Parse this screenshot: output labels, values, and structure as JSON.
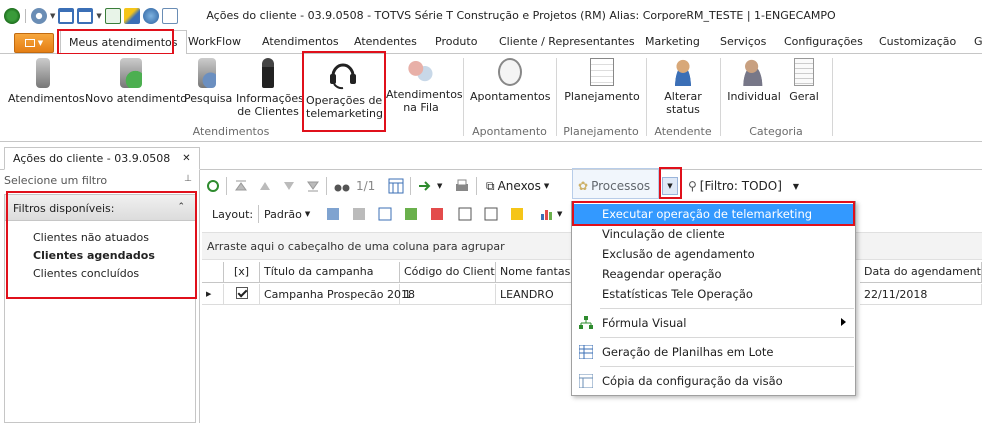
{
  "window": {
    "title": "Ações do cliente - 03.9.0508 - TOTVS Série T Construção e Projetos (RM) Alias: CorporeRM_TESTE | 1-ENGECAMPO"
  },
  "ribbon_tabs": [
    {
      "label": "Meus atendimentos"
    },
    {
      "label": "WorkFlow"
    },
    {
      "label": "Atendimentos"
    },
    {
      "label": "Atendentes"
    },
    {
      "label": "Produto"
    },
    {
      "label": "Cliente / Representantes"
    },
    {
      "label": "Marketing"
    },
    {
      "label": "Serviços"
    },
    {
      "label": "Configurações"
    },
    {
      "label": "Customização"
    },
    {
      "label": "G"
    }
  ],
  "ribbon_buttons": {
    "atendimentos": "Atendimentos",
    "novo_atendimento": "Novo atendimento",
    "pesquisa": "Pesquisa",
    "informacoes_1": "Informações",
    "informacoes_2": "de Clientes",
    "operacoes_1": "Operações de",
    "operacoes_2": "telemarketing",
    "fila_1": "Atendimentos",
    "fila_2": "na Fila",
    "apontamentos": "Apontamentos",
    "planejamento": "Planejamento",
    "alterar_1": "Alterar",
    "alterar_2": "status",
    "individual": "Individual",
    "geral": "Geral"
  },
  "ribbon_groups": {
    "atendimentos": "Atendimentos",
    "apontamento": "Apontamento",
    "planejamento": "Planejamento",
    "atendente": "Atendente",
    "categoria": "Categoria"
  },
  "doc_tab": {
    "label": "Ações do cliente - 03.9.0508",
    "close": "✕"
  },
  "left_panel": {
    "header": "Selecione um filtro",
    "pin": "⊥",
    "filters_title": "Filtros disponíveis:",
    "filters": [
      "Clientes não atuados",
      "Clientes agendados",
      "Clientes concluídos"
    ]
  },
  "toolbar": {
    "page": "1/1",
    "anexos": "Anexos",
    "processos": "Processos",
    "filtro": "[Filtro: TODO]",
    "layout_label": "Layout:",
    "layout_value": "Padrão"
  },
  "group_hint": "Arraste aqui o cabeçalho de uma coluna para agrupar",
  "grid": {
    "columns": [
      "[x]",
      "Título da campanha",
      "Código do Cliente",
      "Nome fantasia",
      "Data do agendamento"
    ],
    "rows": [
      {
        "titulo": "Campanha Prospecão 2018",
        "codigo": "1",
        "nome": "LEANDRO",
        "data": "22/11/2018"
      }
    ]
  },
  "menu": {
    "items": [
      "Executar operação de telemarketing",
      "Vinculação de cliente",
      "Exclusão de agendamento",
      "Reagendar operação",
      "Estatísticas Tele Operação",
      "Fórmula Visual",
      "Geração de Planilhas em Lote",
      "Cópia da configuração da visão"
    ]
  },
  "colors": {
    "accent": "#3399ff",
    "highlight": "#e0101b",
    "file_tab": "#e57e14"
  }
}
